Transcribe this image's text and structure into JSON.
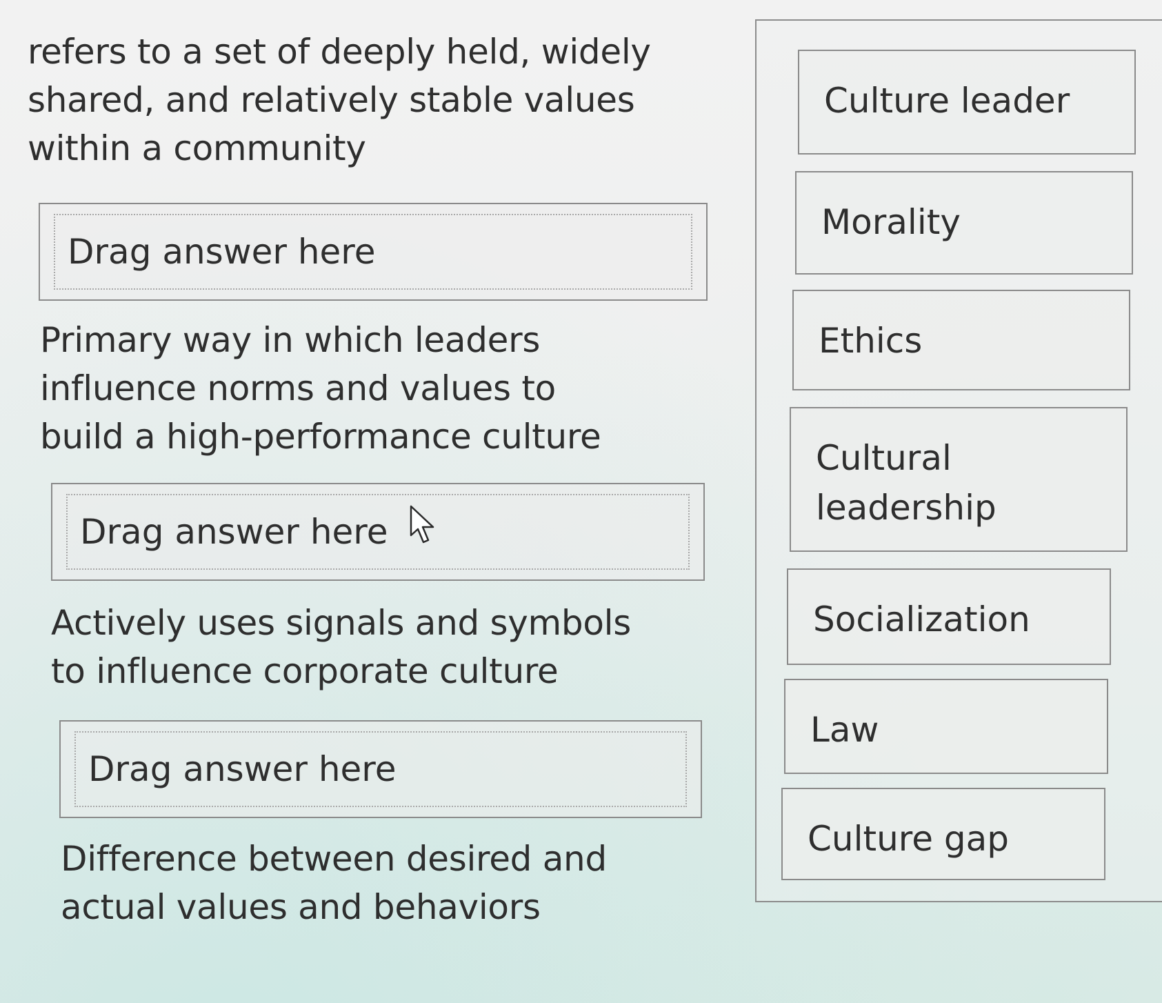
{
  "questions": [
    {
      "prompt": "refers to a set of deeply held, widely shared, and relatively stable values within a community",
      "drop_placeholder": "Drag answer here"
    },
    {
      "prompt": "Primary way in which leaders influence norms and values to build a high-performance culture",
      "drop_placeholder": "Drag answer here"
    },
    {
      "prompt": "Actively uses signals and symbols to influence corporate culture",
      "drop_placeholder": "Drag answer here"
    },
    {
      "prompt": "Difference between desired and actual values and behaviors"
    }
  ],
  "answers": [
    {
      "label": "Culture leader"
    },
    {
      "label": "Morality"
    },
    {
      "label": "Ethics"
    },
    {
      "label": "Cultural leadership"
    },
    {
      "label": "Socialization"
    },
    {
      "label": "Law"
    },
    {
      "label": "Culture gap"
    }
  ],
  "icons": {
    "cursor": "mouse-pointer-icon"
  }
}
